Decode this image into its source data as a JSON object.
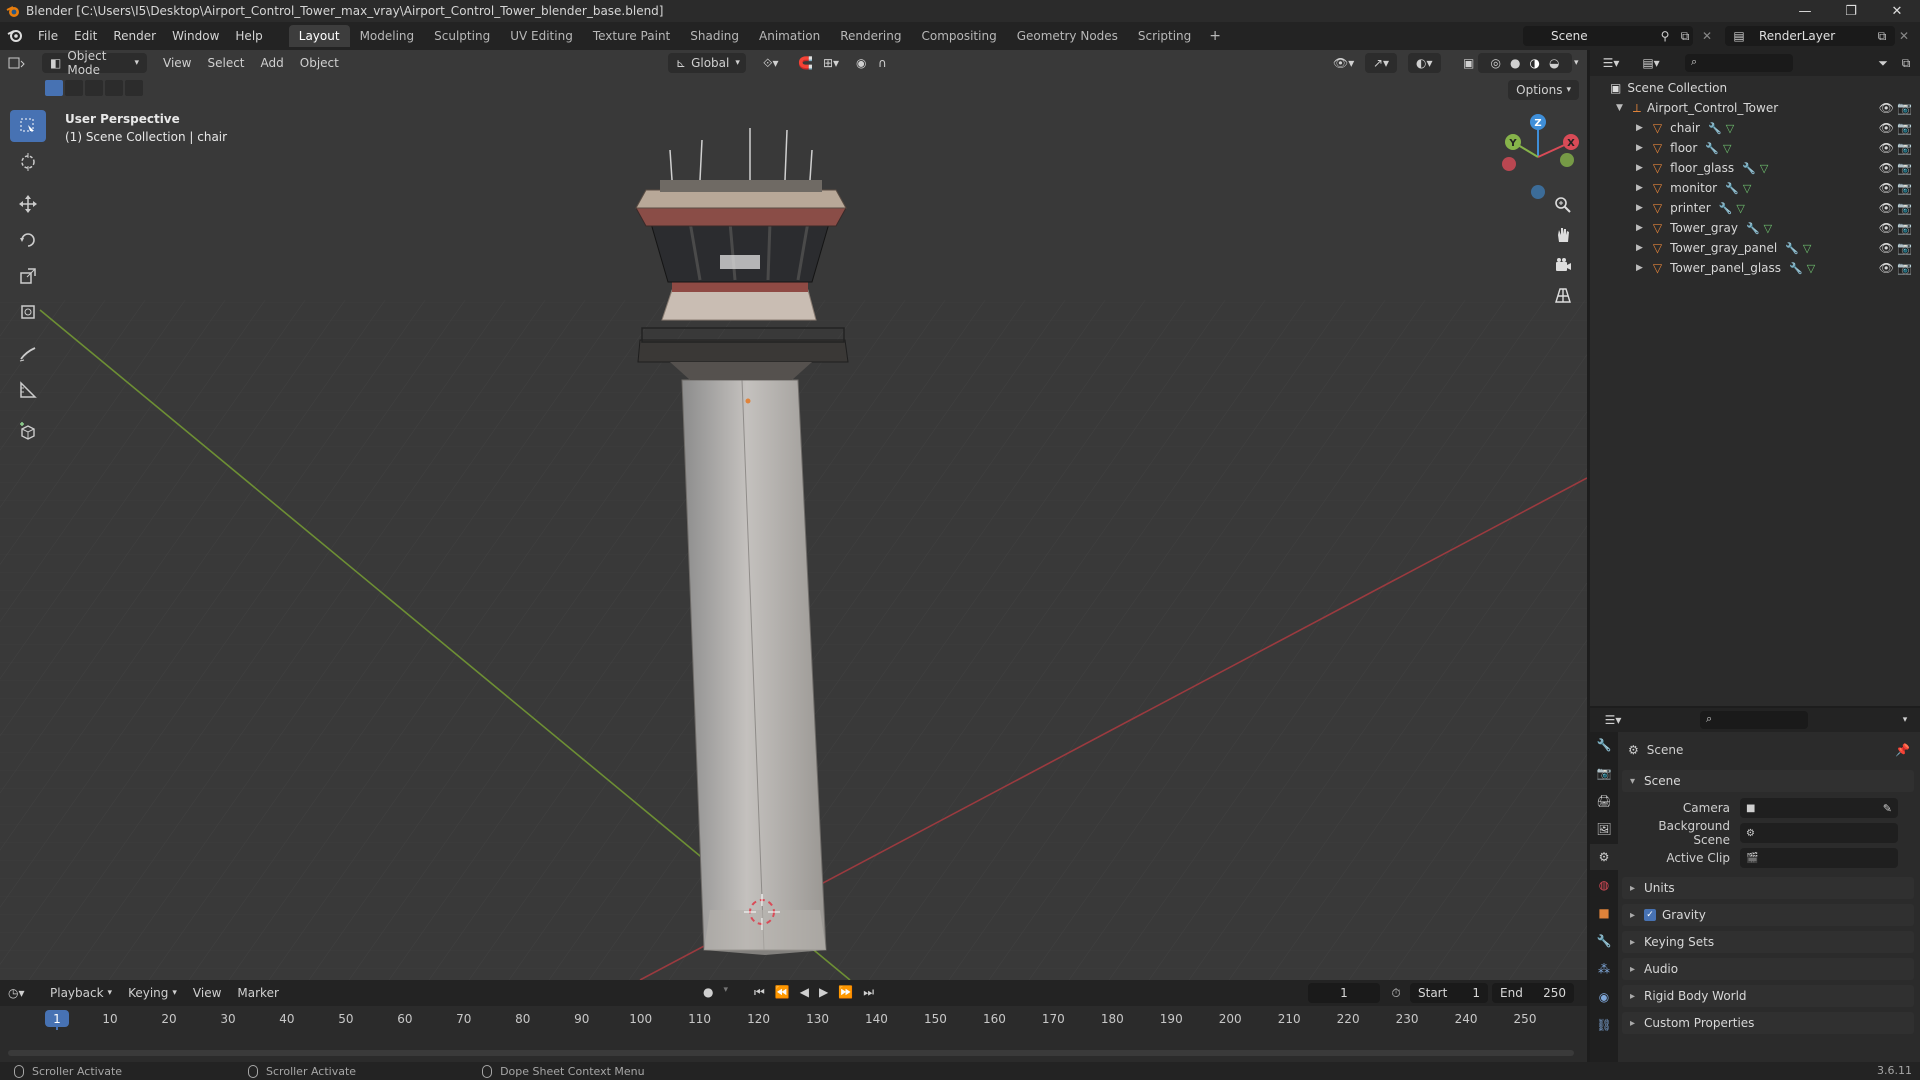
{
  "window": {
    "title": "Blender [C:\\Users\\I5\\Desktop\\Airport_Control_Tower_max_vray\\Airport_Control_Tower_blender_base.blend]",
    "controls": [
      "—",
      "❐",
      "✕"
    ]
  },
  "menu": [
    "File",
    "Edit",
    "Render",
    "Window",
    "Help"
  ],
  "workspaces": {
    "tabs": [
      "Layout",
      "Modeling",
      "Sculpting",
      "UV Editing",
      "Texture Paint",
      "Shading",
      "Animation",
      "Rendering",
      "Compositing",
      "Geometry Nodes",
      "Scripting"
    ],
    "active": "Layout",
    "add": "+"
  },
  "scene_selector": {
    "value": "Scene"
  },
  "render_layer": {
    "value": "RenderLayer"
  },
  "viewport": {
    "mode": "Object Mode",
    "menus": [
      "View",
      "Select",
      "Add",
      "Object"
    ],
    "transform_orientation": "Global",
    "options_label": "Options",
    "perspective_label": "User Perspective",
    "collection_label": "(1) Scene Collection | chair",
    "gizmo": {
      "x": "X",
      "y": "Y",
      "z": "Z"
    }
  },
  "outliner": {
    "root": "Scene Collection",
    "collection": "Airport_Control_Tower",
    "objects": [
      "chair",
      "floor",
      "floor_glass",
      "monitor",
      "printer",
      "Tower_gray",
      "Tower_gray_panel",
      "Tower_panel_glass"
    ]
  },
  "properties": {
    "context": "Scene",
    "panel": "Scene",
    "fields": [
      {
        "label": "Camera",
        "value": ""
      },
      {
        "label": "Background Scene",
        "value": ""
      },
      {
        "label": "Active Clip",
        "value": ""
      }
    ],
    "subpanels": [
      "Units",
      "Gravity",
      "Keying Sets",
      "Audio",
      "Rigid Body World",
      "Custom Properties"
    ],
    "gravity_checked": true
  },
  "timeline": {
    "menus": [
      "Playback",
      "Keying",
      "View",
      "Marker"
    ],
    "current_frame": "1",
    "start_label": "Start",
    "start": "1",
    "end_label": "End",
    "end": "250",
    "ticks": [
      "1",
      "10",
      "20",
      "30",
      "40",
      "50",
      "60",
      "70",
      "80",
      "90",
      "100",
      "110",
      "120",
      "130",
      "140",
      "150",
      "160",
      "170",
      "180",
      "190",
      "200",
      "210",
      "220",
      "230",
      "240",
      "250"
    ]
  },
  "status": {
    "items": [
      "Scroller Activate",
      "Scroller Activate",
      "Dope Sheet Context Menu"
    ],
    "version": "3.6.11"
  },
  "colors": {
    "accent": "#4772b3",
    "x_axis": "#d94b57",
    "y_axis": "#86b34a",
    "z_axis": "#3f8fd9",
    "object_orange": "#e0833a"
  }
}
